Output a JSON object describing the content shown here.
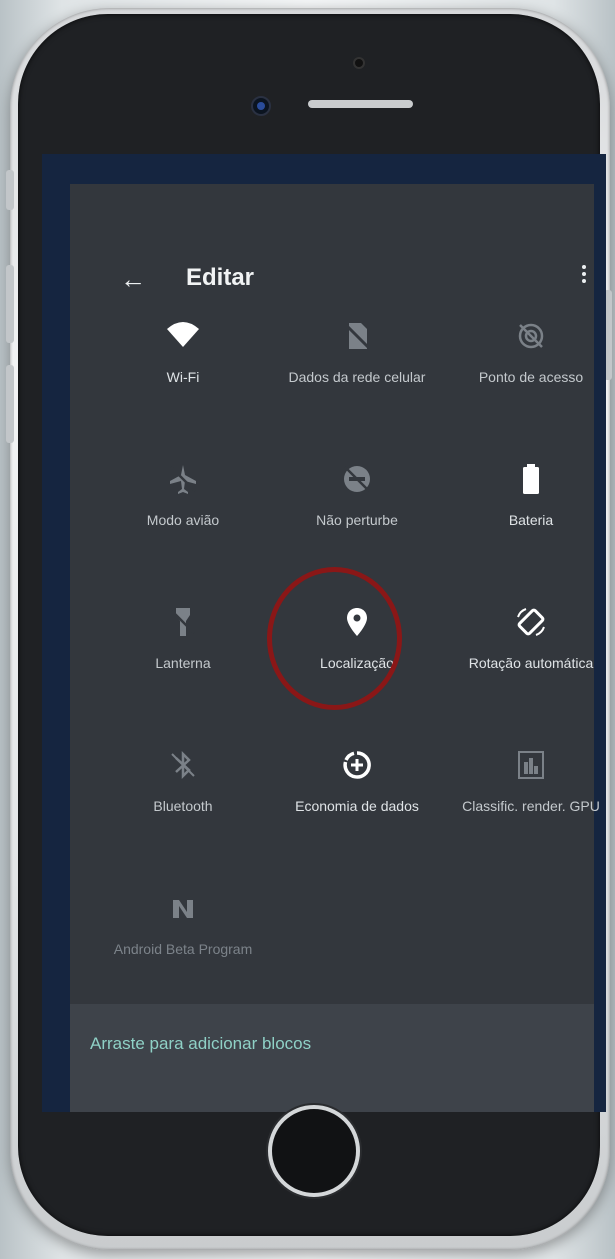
{
  "header": {
    "back_icon": "arrow-left-icon",
    "title": "Editar",
    "menu_icon": "more-vert-icon"
  },
  "tiles": [
    {
      "label": "Wi-Fi",
      "icon": "wifi-icon",
      "state": "active"
    },
    {
      "label": "Dados da rede celular",
      "icon": "cellular-off-icon",
      "state": "inactive"
    },
    {
      "label": "Ponto de acesso",
      "icon": "hotspot-off-icon",
      "state": "inactive"
    },
    {
      "label": "Modo avião",
      "icon": "airplane-icon",
      "state": "inactive"
    },
    {
      "label": "Não perturbe",
      "icon": "do-not-disturb-icon",
      "state": "inactive"
    },
    {
      "label": "Bateria",
      "icon": "battery-icon",
      "state": "active"
    },
    {
      "label": "Lanterna",
      "icon": "flashlight-icon",
      "state": "inactive"
    },
    {
      "label": "Localização",
      "icon": "location-pin-icon",
      "state": "active",
      "highlighted": true
    },
    {
      "label": "Rotação automática",
      "icon": "auto-rotate-icon",
      "state": "active"
    },
    {
      "label": "Bluetooth",
      "icon": "bluetooth-off-icon",
      "state": "inactive"
    },
    {
      "label": "Economia de dados",
      "icon": "data-saver-icon",
      "state": "active"
    },
    {
      "label": "Classific. render. GPU",
      "icon": "gpu-render-icon",
      "state": "inactive"
    },
    {
      "label": "Android Beta Program",
      "icon": "android-beta-icon",
      "state": "disabled"
    }
  ],
  "drag_section": {
    "label": "Arraste para adicionar blocos"
  },
  "colors": {
    "background": "#33373d",
    "accent": "#8fd1c6",
    "highlight_ring": "#8a1717"
  }
}
